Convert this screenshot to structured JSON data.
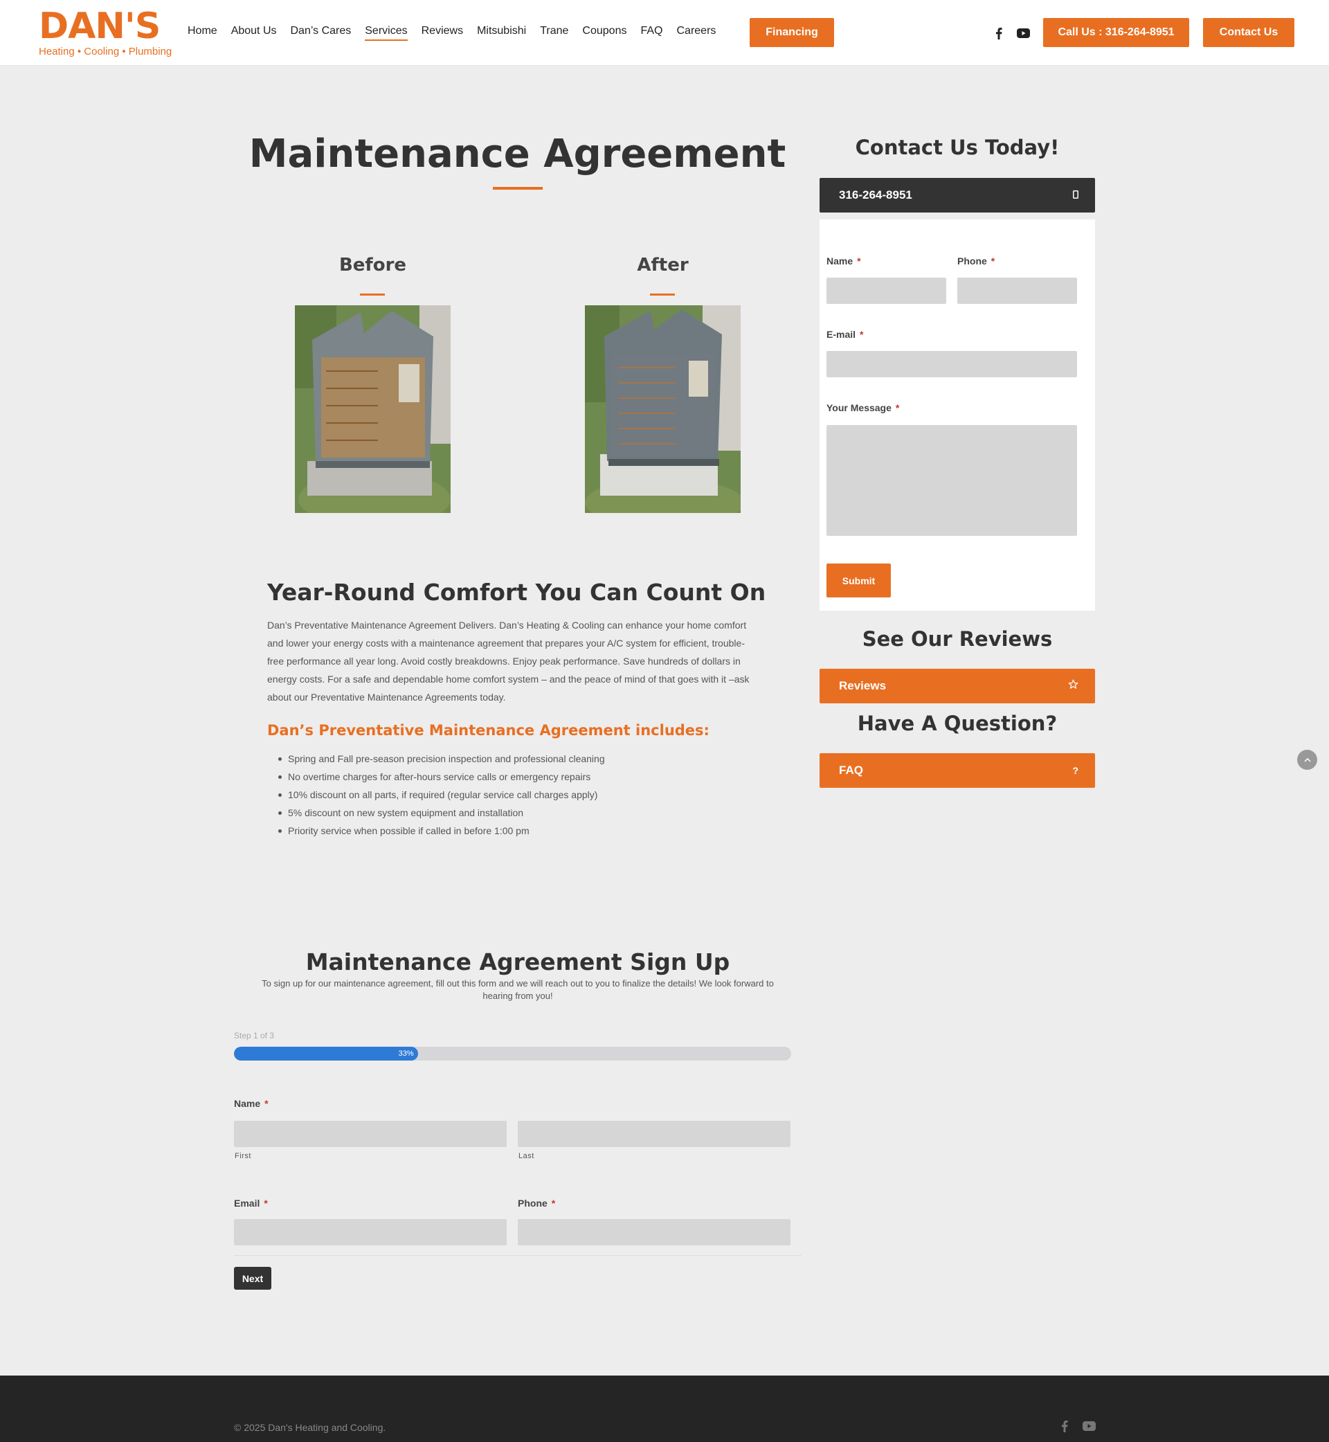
{
  "brand": {
    "name": "DAN'S",
    "tagline": "Heating • Cooling • Plumbing",
    "accent": "#e86f22",
    "dark": "#333333",
    "progress_color": "#2e7bd6"
  },
  "nav": {
    "items": [
      {
        "label": "Home"
      },
      {
        "label": "About Us"
      },
      {
        "label": "Dan’s Cares"
      },
      {
        "label": "Services",
        "active": true
      },
      {
        "label": "Reviews"
      },
      {
        "label": "Mitsubishi"
      },
      {
        "label": "Trane"
      },
      {
        "label": "Coupons"
      },
      {
        "label": "FAQ"
      },
      {
        "label": "Careers"
      }
    ],
    "financing": "Financing",
    "call": "Call Us : 316-264-8951",
    "contact": "Contact Us",
    "social": [
      "facebook-icon",
      "youtube-icon"
    ]
  },
  "main": {
    "title": "Maintenance Agreement",
    "before": "Before",
    "after": "After",
    "section_title": "Year-Round Comfort You Can Count On",
    "paragraph": "Dan’s Preventative Maintenance Agreement Delivers. Dan’s Heating & Cooling can enhance your home comfort and lower your energy costs with a maintenance agreement that prepares your A/C system for efficient, trouble-free performance all year long. Avoid costly breakdowns. Enjoy peak performance. Save hundreds of dollars in energy costs. For a safe and dependable home comfort system – and the peace of mind of that goes with it –ask about our Preventative Maintenance Agreements today.",
    "includes_title": "Dan’s Preventative Maintenance Agreement includes:",
    "includes": [
      "Spring and Fall pre-season precision inspection and professional cleaning",
      "No overtime charges for after-hours service calls or emergency repairs",
      "10% discount on all parts, if required (regular service call charges apply)",
      "5% discount on new system equipment and installation",
      "Priority service when possible if called in before 1:00 pm"
    ]
  },
  "sidebar": {
    "contact_title": "Contact Us Today!",
    "phone": "316-264-8951",
    "form": {
      "name": "Name",
      "phone": "Phone",
      "email": "E-mail",
      "message": "Your Message",
      "required": "*",
      "submit": "Submit"
    },
    "reviews_title": "See Our Reviews",
    "reviews_label": "Reviews",
    "question_title": "Have A Question?",
    "faq_label": "FAQ",
    "faq_icon_text": "?"
  },
  "signup": {
    "title": "Maintenance Agreement Sign Up",
    "description": "To sign up for our maintenance agreement, fill out this form and we will reach out to you to finalize the details! We look forward to hearing from you!",
    "step": "Step 1 of 3",
    "progress_percent": 33,
    "progress_label": "33%",
    "name": "Name",
    "first": "First",
    "last": "Last",
    "email": "Email",
    "phone": "Phone",
    "required": "*",
    "next": "Next"
  },
  "footer": {
    "copyright": "© 2025 Dan's Heating and Cooling."
  }
}
